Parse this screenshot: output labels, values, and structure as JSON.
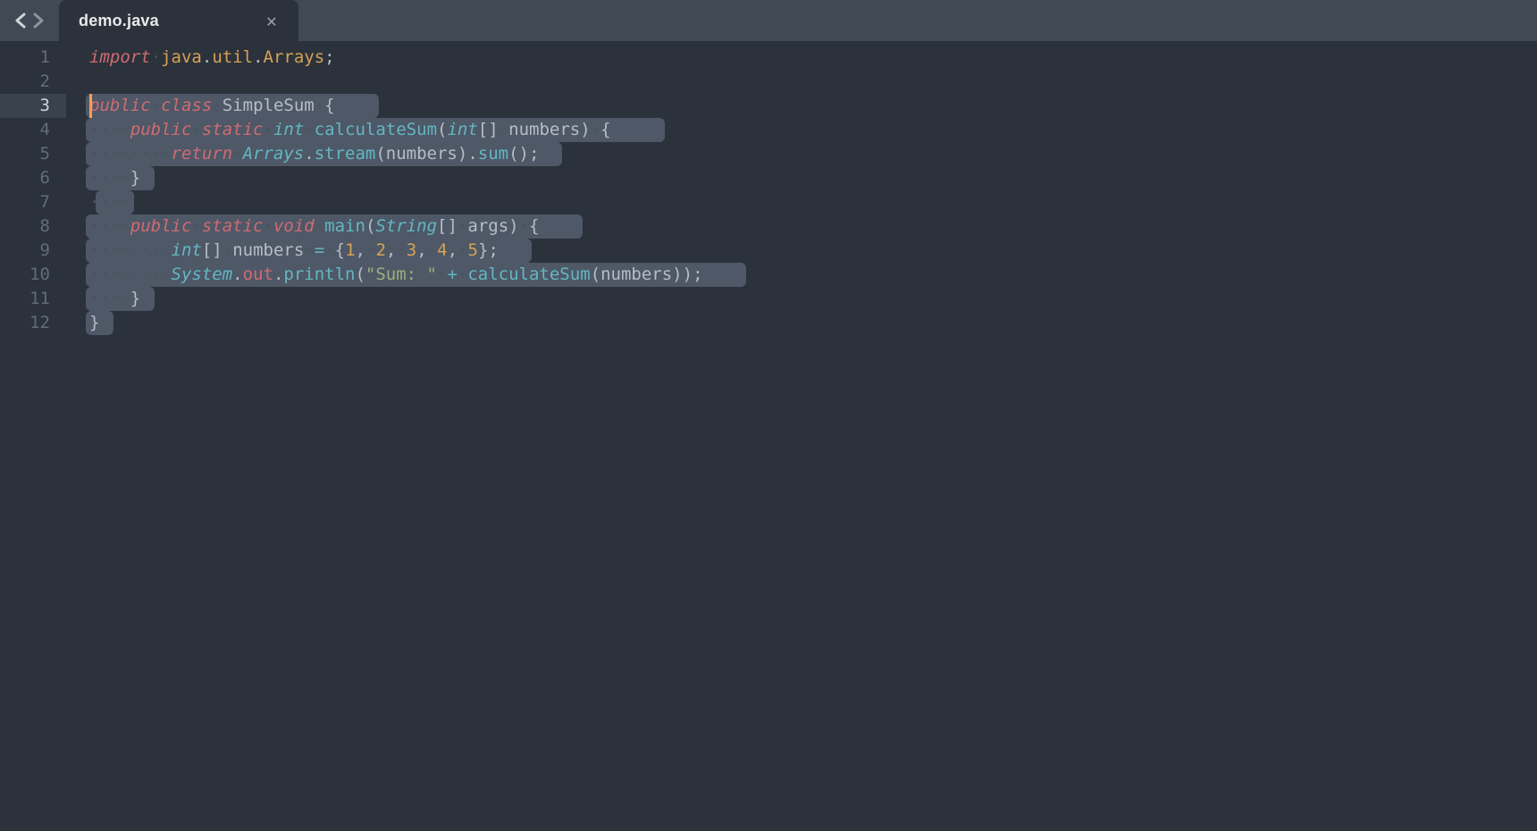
{
  "tab": {
    "title": "demo.java"
  },
  "editor": {
    "active_line": 3,
    "line_numbers": [
      "1",
      "2",
      "3",
      "4",
      "5",
      "6",
      "7",
      "8",
      "9",
      "10",
      "11",
      "12"
    ],
    "lines": [
      {
        "sel": null,
        "tokens": [
          [
            "kw",
            "import"
          ],
          [
            "ws",
            " "
          ],
          [
            "pkg",
            "java"
          ],
          [
            "punc",
            "."
          ],
          [
            "pkg",
            "util"
          ],
          [
            "punc",
            "."
          ],
          [
            "pkg",
            "Arrays"
          ],
          [
            "punc",
            ";"
          ]
        ]
      },
      {
        "sel": null,
        "tokens": []
      },
      {
        "cursor": true,
        "sel": [
          0,
          28
        ],
        "tokens": [
          [
            "kw",
            "public"
          ],
          [
            "ws",
            " "
          ],
          [
            "kw",
            "class"
          ],
          [
            "ws",
            " "
          ],
          [
            "ident",
            "SimpleSum"
          ],
          [
            "ws",
            " "
          ],
          [
            "punc",
            "{"
          ]
        ]
      },
      {
        "sel": [
          0,
          56
        ],
        "tokens": [
          [
            "ws",
            "    "
          ],
          [
            "kw",
            "public"
          ],
          [
            "ws",
            " "
          ],
          [
            "kw",
            "static"
          ],
          [
            "ws",
            " "
          ],
          [
            "type",
            "int"
          ],
          [
            "ws",
            " "
          ],
          [
            "fn",
            "calculateSum"
          ],
          [
            "punc",
            "("
          ],
          [
            "type",
            "int"
          ],
          [
            "punc",
            "[]"
          ],
          [
            "ws",
            " "
          ],
          [
            "ident",
            "numbers"
          ],
          [
            "punc",
            ")"
          ],
          [
            "ws",
            " "
          ],
          [
            "punc",
            "{"
          ]
        ]
      },
      {
        "sel": [
          0,
          46
        ],
        "tokens": [
          [
            "ws",
            "        "
          ],
          [
            "kw",
            "return"
          ],
          [
            "ws",
            " "
          ],
          [
            "type",
            "Arrays"
          ],
          [
            "punc",
            "."
          ],
          [
            "fn",
            "stream"
          ],
          [
            "punc",
            "("
          ],
          [
            "ident",
            "numbers"
          ],
          [
            "punc",
            ")"
          ],
          [
            "punc",
            "."
          ],
          [
            "fn",
            "sum"
          ],
          [
            "punc",
            "()"
          ],
          [
            "punc",
            ";"
          ]
        ]
      },
      {
        "sel": [
          0,
          6
        ],
        "tokens": [
          [
            "ws",
            "    "
          ],
          [
            "punc",
            "}"
          ]
        ]
      },
      {
        "sel": [
          1,
          4
        ],
        "tokens": [
          [
            "ws",
            "    "
          ]
        ]
      },
      {
        "sel": [
          0,
          48
        ],
        "tokens": [
          [
            "ws",
            "    "
          ],
          [
            "kw",
            "public"
          ],
          [
            "ws",
            " "
          ],
          [
            "kw",
            "static"
          ],
          [
            "ws",
            " "
          ],
          [
            "kw",
            "void"
          ],
          [
            "ws",
            " "
          ],
          [
            "fn",
            "main"
          ],
          [
            "punc",
            "("
          ],
          [
            "type",
            "String"
          ],
          [
            "punc",
            "[]"
          ],
          [
            "ws",
            " "
          ],
          [
            "ident",
            "args"
          ],
          [
            "punc",
            ")"
          ],
          [
            "ws",
            " "
          ],
          [
            "punc",
            "{"
          ]
        ]
      },
      {
        "sel": [
          0,
          43
        ],
        "tokens": [
          [
            "ws",
            "        "
          ],
          [
            "type",
            "int"
          ],
          [
            "punc",
            "[]"
          ],
          [
            "ws",
            " "
          ],
          [
            "ident",
            "numbers"
          ],
          [
            "ws",
            " "
          ],
          [
            "op",
            "="
          ],
          [
            "ws",
            " "
          ],
          [
            "punc",
            "{"
          ],
          [
            "num",
            "1"
          ],
          [
            "punc",
            ","
          ],
          [
            "ws",
            " "
          ],
          [
            "num",
            "2"
          ],
          [
            "punc",
            ","
          ],
          [
            "ws",
            " "
          ],
          [
            "num",
            "3"
          ],
          [
            "punc",
            ","
          ],
          [
            "ws",
            " "
          ],
          [
            "num",
            "4"
          ],
          [
            "punc",
            ","
          ],
          [
            "ws",
            " "
          ],
          [
            "num",
            "5"
          ],
          [
            "punc",
            "}"
          ],
          [
            "punc",
            ";"
          ]
        ]
      },
      {
        "sel": [
          0,
          64
        ],
        "tokens": [
          [
            "ws",
            "        "
          ],
          [
            "type",
            "System"
          ],
          [
            "punc",
            "."
          ],
          [
            "member",
            "out"
          ],
          [
            "punc",
            "."
          ],
          [
            "fn",
            "println"
          ],
          [
            "punc",
            "("
          ],
          [
            "str",
            "\"Sum: \""
          ],
          [
            "ws",
            " "
          ],
          [
            "op",
            "+"
          ],
          [
            "ws",
            " "
          ],
          [
            "fn",
            "calculateSum"
          ],
          [
            "punc",
            "("
          ],
          [
            "ident",
            "numbers"
          ],
          [
            "punc",
            ")"
          ],
          [
            "punc",
            ")"
          ],
          [
            "punc",
            ";"
          ]
        ]
      },
      {
        "sel": [
          0,
          6
        ],
        "tokens": [
          [
            "ws",
            "    "
          ],
          [
            "punc",
            "}"
          ]
        ]
      },
      {
        "sel": [
          0,
          2
        ],
        "tokens": [
          [
            "punc",
            "}"
          ]
        ]
      }
    ]
  }
}
